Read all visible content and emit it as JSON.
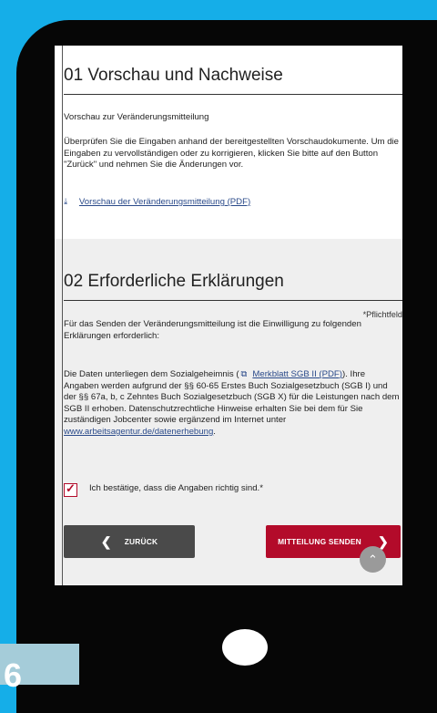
{
  "section1": {
    "title": "01 Vorschau und Nachweise",
    "subtitle": "Vorschau zur Veränderungsmitteilung",
    "instructions": "Überprüfen Sie die Eingaben anhand der bereitgestellten Vorschaudokumente. Um die Eingaben zu vervollständigen oder zu korrigieren, klicken Sie bitte auf den Button \"Zurück\" und nehmen Sie die Änderungen vor.",
    "download_icon": "download-icon",
    "download_link": "Vorschau der Veränderungsmitteilung (PDF)"
  },
  "section2": {
    "title": "02 Erforderliche Erklärungen",
    "required_note": "*Pflichtfeld",
    "intro": "Für das Senden der Veränderungsmitteilung ist die Einwilligung zu folgenden Erklärungen erforderlich:",
    "privacy_prefix": "Die Daten unterliegen dem Sozialgeheimnis (",
    "external_icon": "external-link-icon",
    "privacy_link": "Merkblatt SGB II (PDF)",
    "privacy_mid": "). Ihre Angaben werden aufgrund der §§ 60-65 Erstes Buch Sozialgesetzbuch (SGB I) und der §§ 67a, b, c Zehntes Buch Sozialgesetzbuch (SGB X) für die Leistungen nach dem SGB II erhoben. Datenschutzrechtliche Hinweise erhalten Sie bei dem für Sie zuständigen Jobcenter sowie ergänzend im Internet unter ",
    "privacy_url": "www.arbeitsagentur.de/datenerhebung",
    "privacy_suffix": ".",
    "checkbox_label": "Ich bestätige, dass die Angaben richtig sind.*",
    "checkbox_checked": true
  },
  "buttons": {
    "back": "ZURÜCK",
    "send": "MITTEILUNG SENDEN"
  },
  "colors": {
    "accent": "#b30b2a",
    "secondary_button": "#4a4a4a",
    "background": "#15aee8",
    "section_gray": "#efefef"
  },
  "page_number": "6"
}
